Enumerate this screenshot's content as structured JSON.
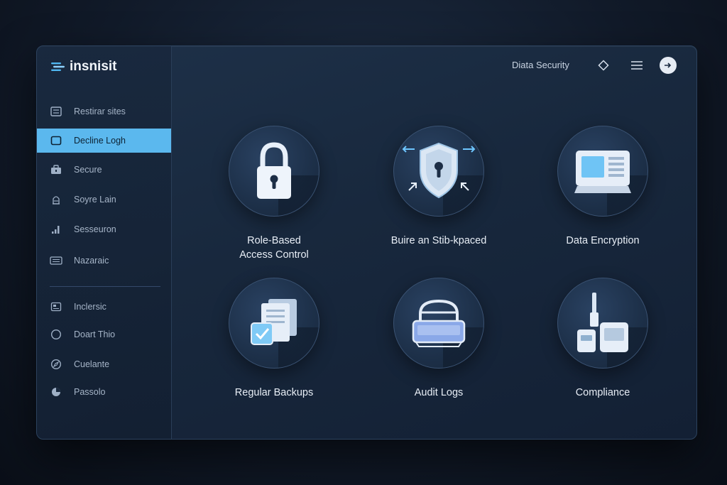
{
  "app": {
    "name": "insnisit"
  },
  "header": {
    "title": "Diata Security"
  },
  "sidebar": {
    "items": [
      {
        "label": "Restirar sites",
        "icon": "server-icon"
      },
      {
        "label": "Decline Logh",
        "icon": "window-icon",
        "active": true
      },
      {
        "label": "Secure",
        "icon": "briefcase-icon"
      },
      {
        "label": "Soyre Lain",
        "icon": "user-lock-icon"
      },
      {
        "label": "Sesseuron",
        "icon": "bar-chart-icon"
      },
      {
        "label": "Nazaraic",
        "icon": "keyboard-icon"
      },
      {
        "label": "Inclersic",
        "icon": "panel-icon"
      },
      {
        "label": "Doart Thio",
        "icon": "circle-icon"
      },
      {
        "label": "Cuelante",
        "icon": "compass-icon"
      },
      {
        "label": "Passolo",
        "icon": "pie-icon"
      }
    ]
  },
  "tiles": [
    {
      "line1": "Role-Based",
      "line2": "Access Control",
      "icon": "padlock-icon"
    },
    {
      "line1": "Buire an Stib-kpaced",
      "line2": "",
      "icon": "shield-keyhole-icon"
    },
    {
      "line1": "Data Encryption",
      "line2": "",
      "icon": "terminal-icon"
    },
    {
      "line1": "Regular Backups",
      "line2": "",
      "icon": "documents-check-icon"
    },
    {
      "line1": "Audit Logs",
      "line2": "",
      "icon": "lock-bag-icon"
    },
    {
      "line1": "Compliance",
      "line2": "",
      "icon": "devices-icon"
    }
  ],
  "colors": {
    "accent": "#5bb8ee",
    "panel": "#18283d",
    "text": "#e8eef6"
  }
}
